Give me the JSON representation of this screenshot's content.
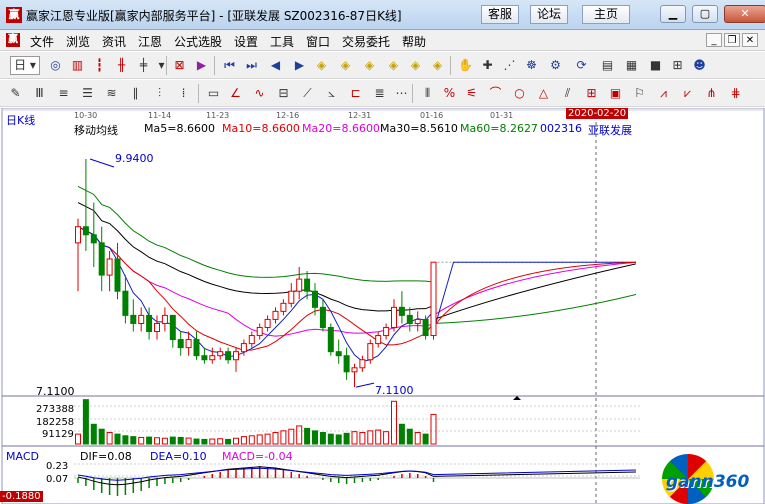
{
  "window": {
    "title": "赢家江恩专业版[赢家内部服务平台] - [亚联发展 SZ002316-87日K线]",
    "buttons": [
      "客服",
      "论坛",
      "主页"
    ]
  },
  "menu": {
    "items": [
      "文件",
      "浏览",
      "资讯",
      "江恩",
      "公式选股",
      "设置",
      "工具",
      "窗口",
      "交易委托",
      "帮助"
    ]
  },
  "toolbar": {
    "period": "日"
  },
  "chart_header": {
    "period_label": "日K线",
    "indicator_name": "移动均线",
    "ma5": "Ma5=8.6600",
    "ma10": "Ma10=8.6600",
    "ma20": "Ma20=8.6600",
    "ma30": "Ma30=8.5610",
    "ma60": "Ma60=8.2627",
    "code": "002316",
    "stock": "亚联发展",
    "date_marker": "2020-02-20",
    "high_label": "9.9400",
    "low_label": "7.1100",
    "price_axis": "7.1100",
    "vol_ticks": [
      "273388",
      "182258",
      "91129"
    ],
    "dates": [
      "10-30",
      "11-14",
      "11-23",
      "12-16",
      "12-31",
      "01-16",
      "01-31"
    ]
  },
  "macd": {
    "name": "MACD",
    "dif": "DIF=0.08",
    "dea": "DEA=0.10",
    "macd": "MACD=-0.04",
    "ticks": [
      "0.23",
      "0.07"
    ],
    "low_value": "-0.1880"
  },
  "brand": {
    "logo_text": "gann360"
  },
  "colors": {
    "up": "#e00000",
    "down": "#008000",
    "ma5": "#000000",
    "ma10": "#e00000",
    "ma20": "#e000e0",
    "ma30": "#000000",
    "ma60": "#008000",
    "accent_blue": "#0000cc"
  },
  "chart_data": {
    "type": "candlestick",
    "candles": [
      {
        "o": 8.9,
        "h": 9.2,
        "l": 8.3,
        "c": 9.1
      },
      {
        "o": 9.1,
        "h": 9.94,
        "l": 8.8,
        "c": 9.0
      },
      {
        "o": 9.0,
        "h": 9.4,
        "l": 8.6,
        "c": 8.9
      },
      {
        "o": 8.9,
        "h": 9.1,
        "l": 8.3,
        "c": 8.5
      },
      {
        "o": 8.5,
        "h": 8.8,
        "l": 8.3,
        "c": 8.7
      },
      {
        "o": 8.7,
        "h": 8.9,
        "l": 8.2,
        "c": 8.3
      },
      {
        "o": 8.3,
        "h": 8.5,
        "l": 7.9,
        "c": 8.0
      },
      {
        "o": 8.0,
        "h": 8.2,
        "l": 7.8,
        "c": 7.9
      },
      {
        "o": 7.9,
        "h": 8.1,
        "l": 7.8,
        "c": 8.0
      },
      {
        "o": 8.0,
        "h": 8.1,
        "l": 7.7,
        "c": 7.8
      },
      {
        "o": 7.8,
        "h": 8.0,
        "l": 7.7,
        "c": 7.9
      },
      {
        "o": 7.9,
        "h": 8.1,
        "l": 7.8,
        "c": 8.0
      },
      {
        "o": 8.0,
        "h": 8.0,
        "l": 7.6,
        "c": 7.7
      },
      {
        "o": 7.7,
        "h": 7.8,
        "l": 7.5,
        "c": 7.6
      },
      {
        "o": 7.6,
        "h": 7.8,
        "l": 7.5,
        "c": 7.7
      },
      {
        "o": 7.7,
        "h": 7.8,
        "l": 7.45,
        "c": 7.5
      },
      {
        "o": 7.5,
        "h": 7.6,
        "l": 7.4,
        "c": 7.45
      },
      {
        "o": 7.45,
        "h": 7.6,
        "l": 7.4,
        "c": 7.5
      },
      {
        "o": 7.5,
        "h": 7.6,
        "l": 7.45,
        "c": 7.55
      },
      {
        "o": 7.55,
        "h": 7.6,
        "l": 7.4,
        "c": 7.45
      },
      {
        "o": 7.45,
        "h": 7.6,
        "l": 7.3,
        "c": 7.55
      },
      {
        "o": 7.55,
        "h": 7.7,
        "l": 7.5,
        "c": 7.65
      },
      {
        "o": 7.65,
        "h": 7.8,
        "l": 7.6,
        "c": 7.75
      },
      {
        "o": 7.75,
        "h": 7.9,
        "l": 7.7,
        "c": 7.85
      },
      {
        "o": 7.85,
        "h": 8.0,
        "l": 7.8,
        "c": 7.95
      },
      {
        "o": 7.95,
        "h": 8.1,
        "l": 7.9,
        "c": 8.05
      },
      {
        "o": 8.05,
        "h": 8.2,
        "l": 8.0,
        "c": 8.15
      },
      {
        "o": 8.15,
        "h": 8.4,
        "l": 8.1,
        "c": 8.3
      },
      {
        "o": 8.3,
        "h": 8.6,
        "l": 8.2,
        "c": 8.45
      },
      {
        "o": 8.45,
        "h": 8.55,
        "l": 8.2,
        "c": 8.3
      },
      {
        "o": 8.3,
        "h": 8.4,
        "l": 8.0,
        "c": 8.1
      },
      {
        "o": 8.1,
        "h": 8.2,
        "l": 7.8,
        "c": 7.85
      },
      {
        "o": 7.85,
        "h": 7.9,
        "l": 7.5,
        "c": 7.55
      },
      {
        "o": 7.55,
        "h": 7.7,
        "l": 7.4,
        "c": 7.5
      },
      {
        "o": 7.5,
        "h": 7.6,
        "l": 7.2,
        "c": 7.3
      },
      {
        "o": 7.3,
        "h": 7.4,
        "l": 7.11,
        "c": 7.35
      },
      {
        "o": 7.35,
        "h": 7.5,
        "l": 7.3,
        "c": 7.45
      },
      {
        "o": 7.45,
        "h": 7.7,
        "l": 7.4,
        "c": 7.65
      },
      {
        "o": 7.65,
        "h": 7.8,
        "l": 7.6,
        "c": 7.75
      },
      {
        "o": 7.75,
        "h": 7.9,
        "l": 7.7,
        "c": 7.85
      },
      {
        "o": 7.85,
        "h": 8.2,
        "l": 7.8,
        "c": 8.1
      },
      {
        "o": 8.1,
        "h": 8.3,
        "l": 7.9,
        "c": 8.0
      },
      {
        "o": 8.0,
        "h": 8.1,
        "l": 7.8,
        "c": 7.9
      },
      {
        "o": 7.9,
        "h": 8.05,
        "l": 7.8,
        "c": 7.95
      },
      {
        "o": 7.95,
        "h": 8.0,
        "l": 7.7,
        "c": 7.75
      },
      {
        "o": 7.75,
        "h": 8.66,
        "l": 7.7,
        "c": 8.66
      }
    ],
    "volume": [
      60000,
      270000,
      120000,
      90000,
      70000,
      60000,
      50000,
      45000,
      40000,
      42000,
      38000,
      35000,
      42000,
      40000,
      36000,
      30000,
      28000,
      30000,
      32000,
      28000,
      35000,
      45000,
      50000,
      55000,
      60000,
      70000,
      80000,
      90000,
      110000,
      95000,
      80000,
      70000,
      60000,
      55000,
      65000,
      75000,
      70000,
      80000,
      85000,
      75000,
      260000,
      120000,
      90000,
      70000,
      60000,
      180000
    ],
    "ma5_future": 8.66,
    "macd_hist": [
      -0.05,
      -0.08,
      -0.12,
      -0.15,
      -0.17,
      -0.18,
      -0.17,
      -0.15,
      -0.13,
      -0.1,
      -0.08,
      -0.06,
      -0.05,
      -0.04,
      -0.02,
      0.0,
      0.02,
      0.04,
      0.06,
      0.08,
      0.09,
      0.1,
      0.11,
      0.12,
      0.11,
      0.1,
      0.08,
      0.06,
      0.04,
      0.02,
      0.0,
      -0.02,
      -0.04,
      -0.05,
      -0.06,
      -0.05,
      -0.04,
      -0.03,
      -0.02,
      0.0,
      0.02,
      0.04,
      0.05,
      0.04,
      0.02,
      -0.04
    ]
  }
}
